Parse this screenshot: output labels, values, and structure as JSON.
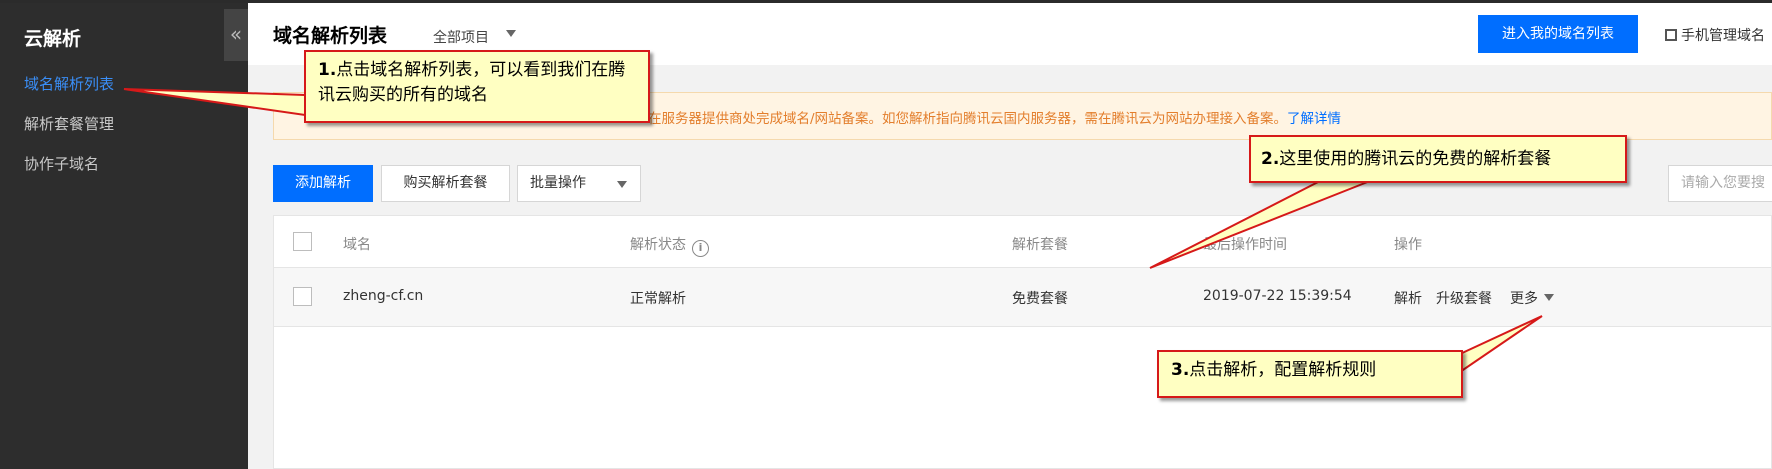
{
  "sidebar": {
    "brand": "云解析",
    "collapse_glyph": "«",
    "items": [
      {
        "label": "域名解析列表",
        "active": true
      },
      {
        "label": "解析套餐管理",
        "active": false
      },
      {
        "label": "协作子域名",
        "active": false
      }
    ]
  },
  "header": {
    "title": "域名解析列表",
    "project_selector": "全部项目",
    "primary_button": "进入我的域名列表",
    "mobile_manage": "手机管理域名"
  },
  "notice": {
    "text": "在服务器提供商处完成域名/网站备案。如您解析指向腾讯云国内服务器，需在腾讯云为网站办理接入备案。",
    "link": "了解详情"
  },
  "toolbar": {
    "add_button": "添加解析",
    "buy_button": "购买解析套餐",
    "batch_select": "批量操作",
    "search_placeholder": "请输入您要搜"
  },
  "table": {
    "columns": [
      "域名",
      "解析状态",
      "解析套餐",
      "最后操作时间",
      "操作"
    ],
    "info_icon_glyph": "i",
    "rows": [
      {
        "domain": "zheng-cf.cn",
        "status": "正常解析",
        "plan": "免费套餐",
        "last_modified": "2019-07-22 15:39:54",
        "actions": {
          "resolve": "解析",
          "upgrade": "升级套餐",
          "more": "更多"
        }
      }
    ]
  },
  "callouts": [
    {
      "number": "1.",
      "text": "点击域名解析列表，可以看到我们在腾讯云购买的所有的域名"
    },
    {
      "number": "2.",
      "text": "这里使用的腾讯云的免费的解析套餐"
    },
    {
      "number": "3.",
      "text": "点击解析，配置解析规则"
    }
  ],
  "colors": {
    "accent": "#006eff",
    "sidebar_bg": "#2d2d2d",
    "status_ok": "#22a640",
    "notice_text": "#e37e2c",
    "callout_bg": "#ffffc2",
    "callout_border": "#d61919"
  }
}
